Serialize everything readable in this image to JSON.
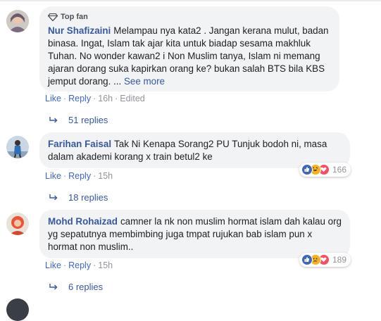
{
  "comments": [
    {
      "author": "Nur Shafizaini",
      "badge": "Top fan",
      "text": "Melampau nya kata2 . Jangan kerana mulut, badan binasa. Ingat, Islam tak ajar kita untuk biadap sesama makhluk Tuhan. No wonder kawan2 i Non Muslim tanya, Islam ni memang ajaran dorang suka kapirkan orang ke? bukan salah BTS bila KBS jemput dorang. ...",
      "see_more": "See more",
      "like": "Like",
      "reply": "Reply",
      "time": "16h",
      "edited": "Edited",
      "replies": "51 replies"
    },
    {
      "author": "Farihan Faisal",
      "text": "Tak Ni Kenapa Sorang2 PU Tunjuk bodoh ni, masa dalam akademi korang x train betul2 ke",
      "like": "Like",
      "reply": "Reply",
      "time": "15h",
      "reaction_count": "166",
      "replies": "18 replies"
    },
    {
      "author": "Mohd Rohaizad",
      "text": "camner la nk non muslim hormat islam dah kalau org yg sepatutnya membimbing juga tmpat rujukan bab islam pun x hormat non muslim..",
      "like": "Like",
      "reply": "Reply",
      "time": "15h",
      "reaction_count": "189",
      "replies": "6 replies"
    }
  ],
  "colors": {
    "link": "#385898",
    "bubble": "#f2f3f5",
    "like_blue": "#4267b2",
    "love_red": "#f25268",
    "haha_yellow": "#f7b125"
  }
}
